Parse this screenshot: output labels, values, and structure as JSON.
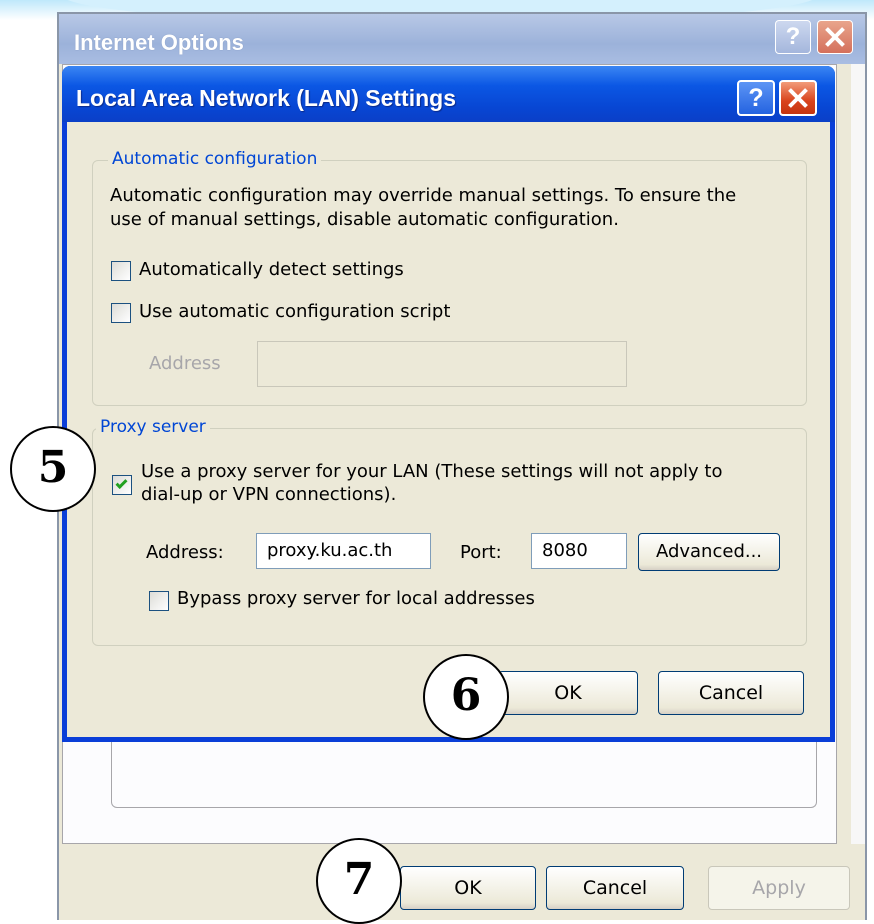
{
  "internet_options": {
    "title": "Internet Options",
    "help_glyph": "?",
    "buttons": {
      "ok": "OK",
      "cancel": "Cancel",
      "apply": "Apply"
    }
  },
  "lan_dialog": {
    "title": "Local Area Network (LAN) Settings",
    "help_glyph": "?",
    "automatic_configuration": {
      "legend": "Automatic configuration",
      "description_line1": "Automatic configuration may override manual settings.  To ensure the",
      "description_line2": "use of manual settings, disable automatic configuration.",
      "auto_detect_label": "Automatically detect settings",
      "auto_detect_checked": false,
      "use_script_label": "Use automatic configuration script",
      "use_script_checked": false,
      "address_label": "Address",
      "address_value": ""
    },
    "proxy_server": {
      "legend": "Proxy server",
      "use_proxy_line1": "Use a proxy server for your LAN (These settings will not apply to",
      "use_proxy_line2": "dial-up or VPN connections).",
      "use_proxy_checked": true,
      "address_label": "Address:",
      "address_value": "proxy.ku.ac.th",
      "port_label": "Port:",
      "port_value": "8080",
      "advanced_label": "Advanced...",
      "bypass_label": "Bypass proxy server for local addresses",
      "bypass_checked": false
    },
    "buttons": {
      "ok": "OK",
      "cancel": "Cancel"
    }
  },
  "steps": {
    "step5": "5",
    "step6": "6",
    "step7": "7"
  },
  "colors": {
    "xp_blue_titlebar": "#0846d3",
    "dialog_face": "#ece9d8",
    "groupbox_label": "#0046d5",
    "close_red": "#d9431c",
    "checkmark_green": "#21a121"
  }
}
